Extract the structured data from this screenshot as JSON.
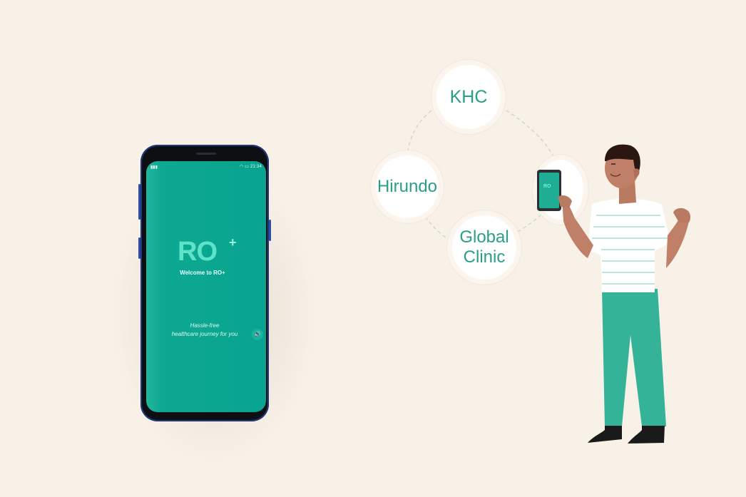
{
  "phone": {
    "status_time": "21:34",
    "logo_text": "RO",
    "logo_plus": "+",
    "welcome_text": "Welcome to RO+",
    "tagline_line1": "Hassle-free",
    "tagline_line2": "healthcare journey for you",
    "sound_icon": "speaker-icon"
  },
  "network": {
    "nodes": [
      "KHC",
      "Hirundo",
      "Global Clinic"
    ],
    "khc": "KHC",
    "hirundo": "Hirundo",
    "global_line1": "Global",
    "global_line2": "Clinic"
  },
  "colors": {
    "background": "#f8f1e8",
    "brand_teal": "#0ea892",
    "bubble_text": "#2a9e87",
    "phone_frame": "#243e8a"
  }
}
